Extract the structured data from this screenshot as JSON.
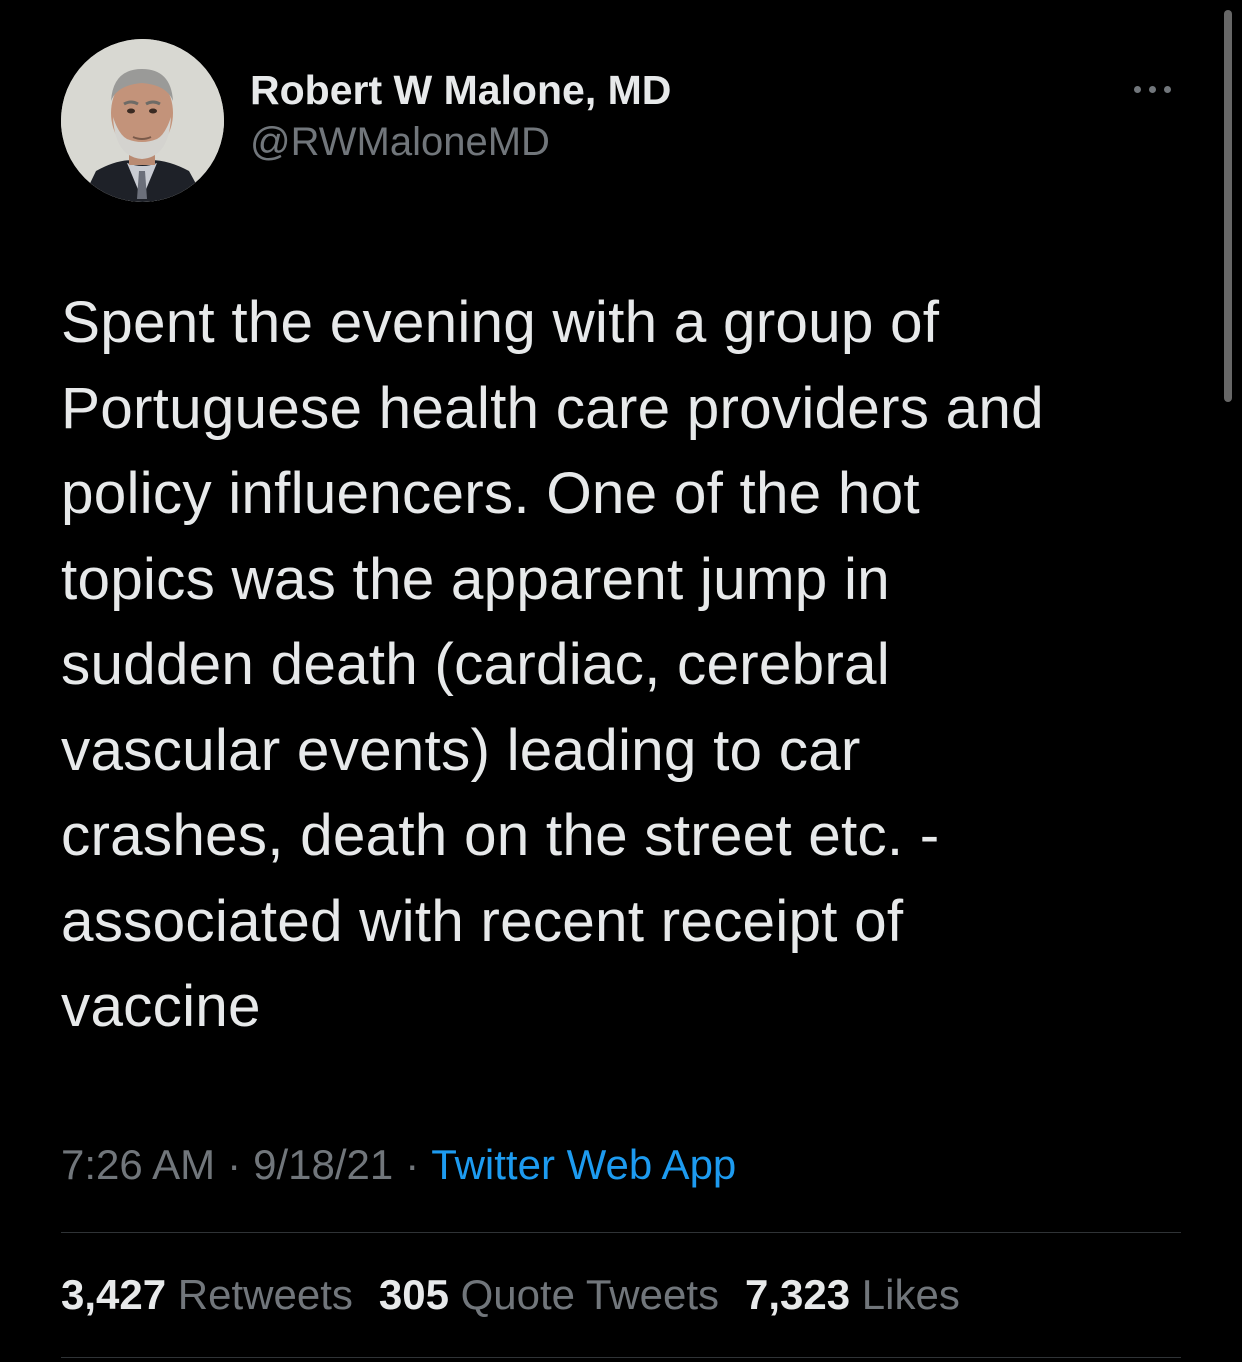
{
  "author": {
    "display_name": "Robert W Malone, MD",
    "handle": "@RWMaloneMD",
    "avatar_icon": "profile-photo"
  },
  "more_icon": "more-options-icon",
  "tweet": {
    "text": "Spent the evening with a group of\nPortuguese health care providers and\npolicy influencers.  One of the hot\ntopics was the apparent jump in\nsudden death (cardiac, cerebral\nvascular events) leading to car\ncrashes, death on the street etc. -\nassociated with recent receipt of\nvaccine"
  },
  "meta": {
    "time": "7:26 AM",
    "separator": "·",
    "date": "9/18/21",
    "source": "Twitter Web App"
  },
  "stats": {
    "retweets_count": "3,427",
    "retweets_label": "Retweets",
    "quotes_count": "305",
    "quotes_label": "Quote Tweets",
    "likes_count": "7,323",
    "likes_label": "Likes"
  },
  "colors": {
    "background": "#000000",
    "text": "#e7e9ea",
    "secondary": "#71767b",
    "link": "#1d9bf0",
    "divider": "#2f3336"
  }
}
